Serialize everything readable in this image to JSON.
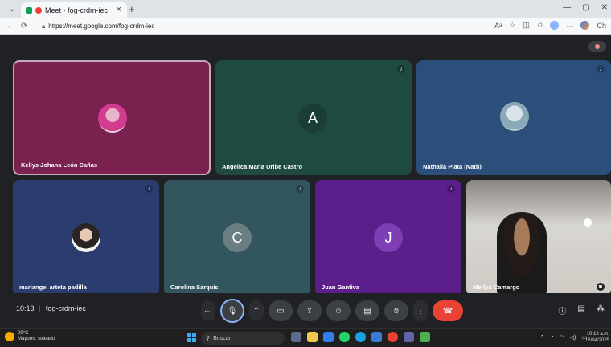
{
  "browser": {
    "tab_title": "Meet - fog-crdm-iec",
    "url": "https://meet.google.com/fog-crdm-iec",
    "profile_label": "Ch"
  },
  "tiles": [
    {
      "name": "Kellys Johana León Cañas",
      "type": "photo",
      "muted": false,
      "bg": "#7a2150"
    },
    {
      "name": "Angelica Maria Uribe Castro",
      "type": "letter",
      "letter": "A",
      "muted": true,
      "bg": "#1f4a40"
    },
    {
      "name": "Nathalia Plata (Nath)",
      "type": "photo",
      "muted": true,
      "bg": "#2b4f7a"
    },
    {
      "name": "mariangel arteta padilla",
      "type": "photo",
      "muted": true,
      "bg": "#2b3d6e"
    },
    {
      "name": "Carolina Sarquis",
      "type": "letter",
      "letter": "C",
      "muted": true,
      "bg": "#33555d"
    },
    {
      "name": "Juan Gantiva",
      "type": "letter",
      "letter": "J",
      "muted": true,
      "bg": "#5c1e8a"
    },
    {
      "name": "Merlys Camargo",
      "type": "video",
      "muted": false,
      "bg": "#6f6a66"
    }
  ],
  "meeting": {
    "time": "10:13",
    "code": "fog-crdm-iec"
  },
  "taskbar": {
    "temperature": "29°C",
    "weather": "Mayorm. soleado",
    "search_placeholder": "Buscar",
    "clock_time": "10:13 a.m.",
    "clock_date": "16/04/2025"
  },
  "colors": {
    "hangup": "#ea4335",
    "active_mic_ring": "#8ab4f8",
    "background": "#202124"
  }
}
